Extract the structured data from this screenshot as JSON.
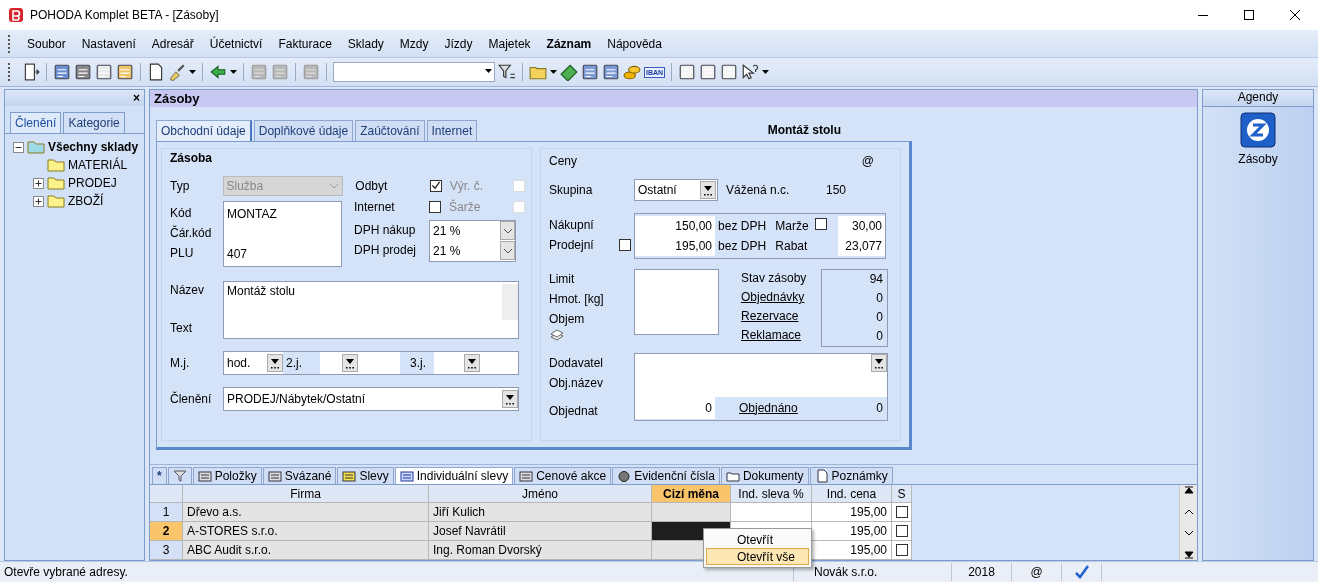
{
  "window": {
    "title": "POHODA Komplet BETA - [Zásoby]"
  },
  "menu": [
    {
      "label": "Soubor",
      "bold": false
    },
    {
      "label": "Nastavení",
      "bold": false
    },
    {
      "label": "Adresář",
      "bold": false
    },
    {
      "label": "Účetnictví",
      "bold": false
    },
    {
      "label": "Fakturace",
      "bold": false
    },
    {
      "label": "Sklady",
      "bold": false
    },
    {
      "label": "Mzdy",
      "bold": false
    },
    {
      "label": "Jízdy",
      "bold": false
    },
    {
      "label": "Majetek",
      "bold": false
    },
    {
      "label": "Záznam",
      "bold": true
    },
    {
      "label": "Nápověda",
      "bold": false
    }
  ],
  "toolbar": {
    "iban_label": "IBAN"
  },
  "left_panel": {
    "close": "×",
    "tabs": [
      {
        "label": "Členění",
        "selected": true
      },
      {
        "label": "Kategorie",
        "selected": false
      }
    ],
    "tree": [
      {
        "label": "Všechny sklady",
        "expanded": true,
        "children": [
          {
            "label": "MATERIÁL"
          },
          {
            "label": "PRODEJ",
            "expanded": false
          },
          {
            "label": "ZBOŽÍ",
            "expanded": false
          }
        ]
      }
    ]
  },
  "agenda_header": "Zásoby",
  "form": {
    "tabs": [
      {
        "label": "Obchodní údaje",
        "selected": true
      },
      {
        "label": "Doplňkové údaje",
        "selected": false
      },
      {
        "label": "Zaúčtování",
        "selected": false
      },
      {
        "label": "Internet",
        "selected": false
      }
    ],
    "record_title": "Montáž stolu",
    "stock": {
      "title": "Zásoba",
      "type_label": "Typ",
      "type_value": "Služba",
      "type_disabled": true,
      "codes": [
        {
          "label": "Kód",
          "value": "MONTAZ"
        },
        {
          "label": "Čár.kód"
        },
        {
          "label": "PLU",
          "value": "407"
        }
      ],
      "flags": [
        {
          "label": "Odbyt",
          "checked": true,
          "sub_label": "Výr. č.",
          "sub_disabled": true,
          "sub_checked": false
        },
        {
          "label": "Internet",
          "checked": false,
          "sub_label": "Šarže",
          "sub_disabled": true,
          "sub_checked": false
        }
      ],
      "vat": [
        {
          "label": "DPH nákup",
          "value": "21 %"
        },
        {
          "label": "DPH prodej",
          "value": "21 %"
        }
      ],
      "name_label": "Název",
      "name_value": "Montáž stolu",
      "text_label": "Text",
      "units_label": "M.j.",
      "units": [
        {
          "value": "hod."
        },
        {
          "label": "2.j."
        },
        {
          "label": "3.j."
        }
      ],
      "category_label": "Členění",
      "category_value": "PRODEJ/Nábytek/Ostatní"
    },
    "prices": {
      "title": "Ceny",
      "at": "@",
      "group_label": "Skupina",
      "group_value": "Ostatní",
      "weighted_label": "Vážená n.c.",
      "weighted_value": "150",
      "rows": [
        {
          "label": "Nákupní",
          "value": "150,00",
          "unit": "bez DPH",
          "extra_label": "Marže",
          "extra_checked": false,
          "extra_value": "30,00"
        },
        {
          "label": "Prodejní",
          "checked": false,
          "value": "195,00",
          "unit": "bez DPH",
          "extra_label": "Rabat",
          "extra_value": "23,077"
        }
      ],
      "limits": [
        {
          "label": "Limit"
        },
        {
          "label": "Hmot. [kg]"
        },
        {
          "label": "Objem"
        }
      ],
      "stock_levels": [
        {
          "label": "Stav zásoby",
          "link": false,
          "value": "94"
        },
        {
          "label": "Objednávky",
          "link": true,
          "value": "0"
        },
        {
          "label": "Rezervace",
          "link": true,
          "value": "0"
        },
        {
          "label": "Reklamace",
          "link": true,
          "value": "0"
        }
      ],
      "supplier_label": "Dodavatel",
      "order_name_label": "Obj.název",
      "order_label": "Objednat",
      "order_value": "0",
      "ordered_label": "Objednáno",
      "ordered_value": "0"
    }
  },
  "detail_tabs": [
    {
      "kind": "text",
      "label": "*",
      "selected": false
    },
    {
      "kind": "filter",
      "selected": false
    },
    {
      "kind": "grid",
      "label": "Položky",
      "selected": false
    },
    {
      "kind": "grid",
      "label": "Svázané",
      "selected": false
    },
    {
      "kind": "stripes",
      "label": "Slevy",
      "selected": false
    },
    {
      "kind": "list",
      "label": "Individuální slevy",
      "selected": true
    },
    {
      "kind": "grid",
      "label": "Cenové akce",
      "selected": false
    },
    {
      "kind": "disc",
      "label": "Evidenční čísla",
      "selected": false
    },
    {
      "kind": "folder",
      "label": "Dokumenty",
      "selected": false
    },
    {
      "kind": "page",
      "label": "Poznámky",
      "selected": false
    }
  ],
  "table": {
    "columns": [
      {
        "label": "Firma",
        "highlighted": false
      },
      {
        "label": "Jméno",
        "highlighted": false
      },
      {
        "label": "Cizí měna",
        "highlighted": true
      },
      {
        "label": "Ind. sleva %",
        "highlighted": false
      },
      {
        "label": "Ind. cena",
        "highlighted": false
      },
      {
        "label": "S",
        "highlighted": false
      }
    ],
    "rows": [
      {
        "number": "1",
        "selected": false,
        "firma": "Dřevo a.s.",
        "jmeno": "Jiří Kulich",
        "ind_cena": "195,00",
        "s": false
      },
      {
        "number": "2",
        "selected": true,
        "firma": "A-STORES s.r.o.",
        "jmeno": "Josef Navrátil",
        "ind_cena": "195,00",
        "s": false
      },
      {
        "number": "3",
        "selected": false,
        "firma": "ABC Audit s.r.o.",
        "jmeno": "Ing. Roman Dvorský",
        "ind_cena": "195,00",
        "s": false
      }
    ]
  },
  "context_menu": [
    {
      "label": "Otevřít",
      "selected": false
    },
    {
      "label": "Otevřít vše",
      "selected": true
    }
  ],
  "agenda": {
    "title": "Agendy",
    "items": [
      {
        "label": "Zásoby"
      }
    ]
  },
  "status_bar": {
    "message": "Otevře vybrané adresy.",
    "company": "Novák s.r.o.",
    "year": "2018",
    "at": "@"
  }
}
